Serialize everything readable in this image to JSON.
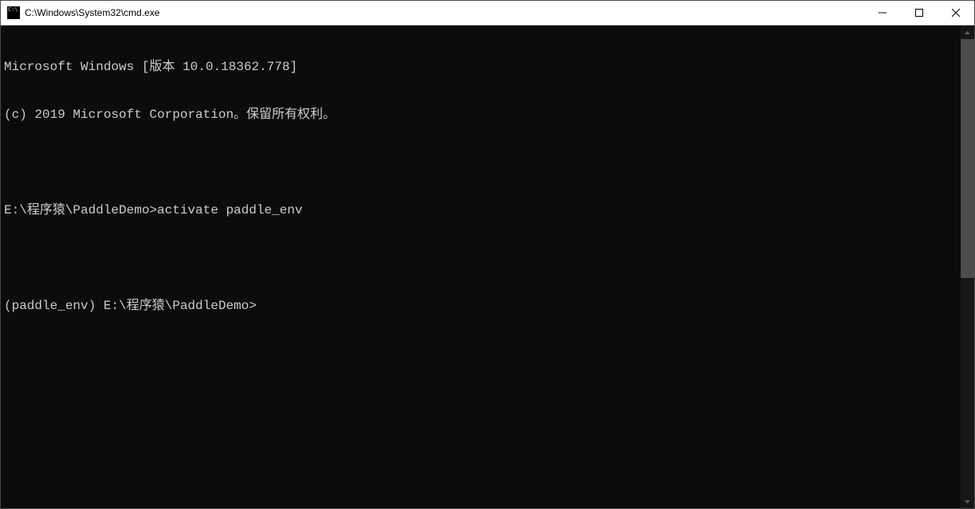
{
  "titlebar": {
    "title": "C:\\Windows\\System32\\cmd.exe"
  },
  "terminal": {
    "lines": [
      "Microsoft Windows [版本 10.0.18362.778]",
      "(c) 2019 Microsoft Corporation。保留所有权利。",
      "",
      "E:\\程序猿\\PaddleDemo>activate paddle_env",
      "",
      "(paddle_env) E:\\程序猿\\PaddleDemo>"
    ]
  }
}
